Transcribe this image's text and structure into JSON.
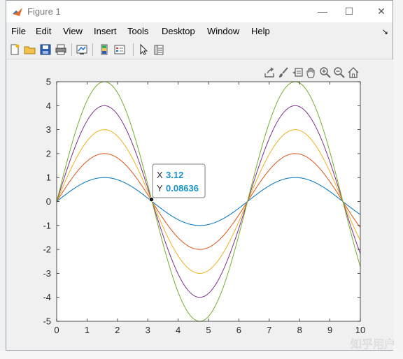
{
  "window": {
    "title": "Figure 1",
    "minimize_label": "—",
    "maximize_label": "☐",
    "close_label": "✕"
  },
  "menu": [
    {
      "label": "File"
    },
    {
      "label": "Edit"
    },
    {
      "label": "View"
    },
    {
      "label": "Insert"
    },
    {
      "label": "Tools"
    },
    {
      "label": "Desktop"
    },
    {
      "label": "Window"
    },
    {
      "label": "Help"
    }
  ],
  "toolbar_icons": [
    "new-figure-icon",
    "open-file-icon",
    "save-icon",
    "print-icon",
    "link-plot-icon",
    "insert-colorbar-icon",
    "insert-legend-icon",
    "pointer-icon",
    "property-inspector-icon"
  ],
  "axes_toolbar_icons": [
    "export-icon",
    "brush-icon",
    "data-tips-icon",
    "pan-icon",
    "zoom-in-icon",
    "zoom-out-icon",
    "home-icon"
  ],
  "colors": {
    "accent_datatip": "#1a92c8",
    "series": [
      "#0072BD",
      "#D95319",
      "#EDB120",
      "#7E2F8E",
      "#77AC30"
    ]
  },
  "datatip": {
    "x_label": "X",
    "x_value": "3.12",
    "y_label": "Y",
    "y_value": "0.08636"
  },
  "watermark": "知乎用户",
  "chart_data": {
    "type": "line",
    "function": "k*sin(x)",
    "x_range": [
      0,
      10
    ],
    "xlim": [
      0,
      10
    ],
    "ylim": [
      -5,
      5
    ],
    "xticks": [
      0,
      1,
      2,
      3,
      4,
      5,
      6,
      7,
      8,
      9,
      10
    ],
    "yticks": [
      -5,
      -4,
      -3,
      -2,
      -1,
      0,
      1,
      2,
      3,
      4,
      5
    ],
    "grid": false,
    "series": [
      {
        "amplitude": 1
      },
      {
        "amplitude": 2
      },
      {
        "amplitude": 3
      },
      {
        "amplitude": 4
      },
      {
        "amplitude": 5
      }
    ],
    "datatip_point": {
      "x": 3.12,
      "y": 0.08636
    }
  }
}
